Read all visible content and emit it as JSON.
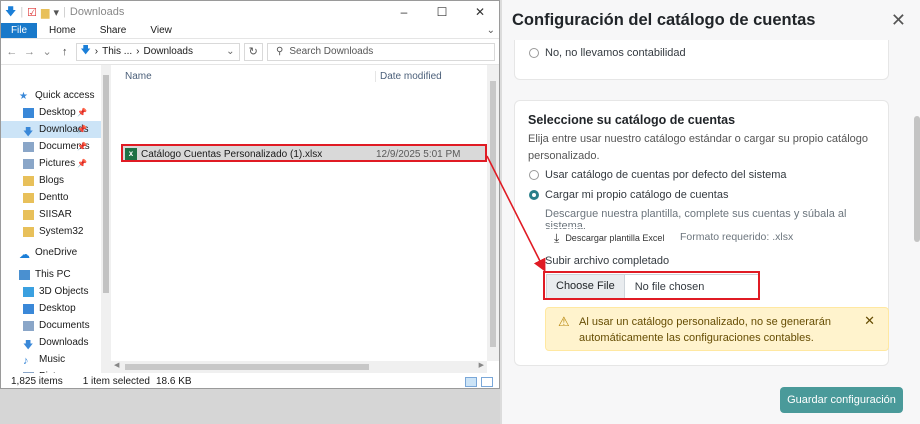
{
  "explorer": {
    "title": "Downloads",
    "window_controls": {
      "minimize": "–",
      "maximize": "☐",
      "close": "✕"
    },
    "ribbon_tabs": [
      "File",
      "Home",
      "Share",
      "View"
    ],
    "address": {
      "prefix": "This ...",
      "separator": "›",
      "current": "Downloads"
    },
    "search_placeholder": "Search Downloads",
    "nav_items": [
      {
        "label": "Quick access",
        "icon": "star-icon",
        "color": "#3a88d8"
      },
      {
        "label": "Desktop",
        "icon": "desktop-icon",
        "color": "#3a88d8"
      },
      {
        "label": "Downloads",
        "icon": "download-icon",
        "color": "#3a88d8"
      },
      {
        "label": "Documents",
        "icon": "documents-icon",
        "color": "#8aa6c8"
      },
      {
        "label": "Pictures",
        "icon": "pictures-icon",
        "color": "#8aa6c8"
      },
      {
        "label": "Blogs",
        "icon": "folder-icon",
        "color": "#e8c05a"
      },
      {
        "label": "Dentto",
        "icon": "folder-icon",
        "color": "#e8c05a"
      },
      {
        "label": "SIISAR",
        "icon": "folder-icon",
        "color": "#e8c05a"
      },
      {
        "label": "System32",
        "icon": "folder-icon",
        "color": "#e8c05a"
      },
      {
        "label": "OneDrive",
        "icon": "cloud-icon",
        "color": "#1b7fd8"
      },
      {
        "label": "This PC",
        "icon": "computer-icon",
        "color": "#4a90d0"
      },
      {
        "label": "3D Objects",
        "icon": "cube-icon",
        "color": "#3aa0e0"
      },
      {
        "label": "Desktop",
        "icon": "desktop-icon",
        "color": "#3a88d8"
      },
      {
        "label": "Documents",
        "icon": "documents-icon",
        "color": "#8aa6c8"
      },
      {
        "label": "Downloads",
        "icon": "download-icon",
        "color": "#3a88d8"
      },
      {
        "label": "Music",
        "icon": "music-icon",
        "color": "#3a88d8"
      },
      {
        "label": "Pictures",
        "icon": "pictures-icon",
        "color": "#8aa6c8"
      }
    ],
    "columns": {
      "name": "Name",
      "date": "Date modified"
    },
    "file": {
      "name": "Catálogo Cuentas Personalizado (1).xlsx",
      "date": "12/9/2025 5:01 PM"
    },
    "status": {
      "count": "1,825 items",
      "selected": "1 item selected",
      "size": "18.6 KB"
    }
  },
  "panel": {
    "title": "Configuración del catálogo de cuentas",
    "prev_option": "No, no llevamos contabilidad",
    "section_title": "Seleccione su catálogo de cuentas",
    "section_desc": "Elija entre usar nuestro catálogo estándar o cargar su propio catálogo personalizado.",
    "option_default": "Usar catálogo de cuentas por defecto del sistema",
    "option_custom": "Cargar mi propio catálogo de cuentas",
    "help_text": "Descargue nuestra plantilla, complete sus cuentas y súbala al sistema.",
    "download_label": "Descargar plantilla Excel",
    "format_text": "Formato requerido: .xlsx",
    "upload_label": "Subir archivo completado",
    "choose_file": "Choose File",
    "no_file": "No file chosen",
    "alert_text": "Al usar un catálogo personalizado, no se generarán automáticamente las configuraciones contables.",
    "save_label": "Guardar configuración",
    "accent": "#4a9a9a",
    "annotation_color": "#e01b24"
  }
}
